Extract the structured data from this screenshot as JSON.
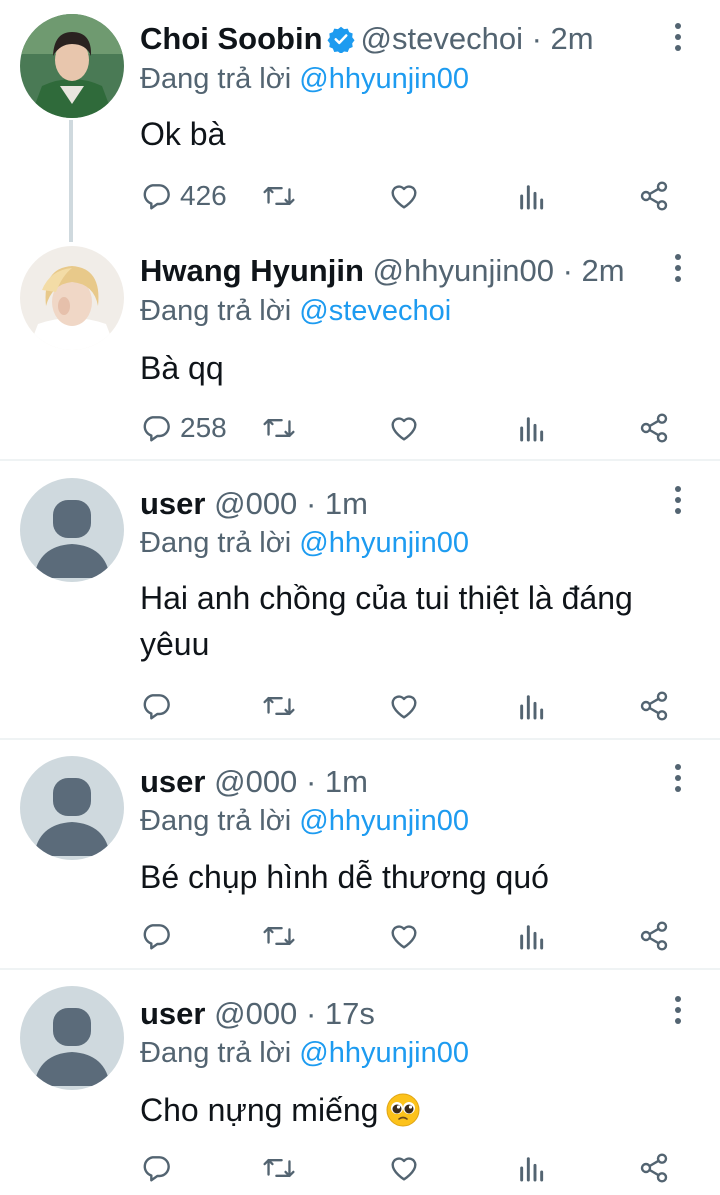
{
  "tweets": [
    {
      "name": "Choi Soobin",
      "verified": true,
      "handle": "@stevechoi",
      "dot": "·",
      "time": "2m",
      "reply_prefix": "Đang trả lời",
      "reply_to": "@hhyunjin00",
      "text": "Ok bà",
      "reply_count": "426",
      "avatar": "photo-green-jacket"
    },
    {
      "name": "Hwang Hyunjin",
      "verified": false,
      "handle": "@hhyunjin00",
      "dot": "·",
      "time": "2m",
      "reply_prefix": "Đang trả lời",
      "reply_to": "@stevechoi",
      "text": "Bà qq",
      "reply_count": "258",
      "avatar": "photo-blonde"
    },
    {
      "name": "user",
      "verified": false,
      "handle": "@000",
      "dot": "·",
      "time": "1m",
      "reply_prefix": "Đang trả lời",
      "reply_to": "@hhyunjin00",
      "text": "Hai anh chồng của tui thiệt là đáng yêuu",
      "reply_count": "",
      "avatar": "default"
    },
    {
      "name": "user",
      "verified": false,
      "handle": "@000",
      "dot": "·",
      "time": "1m",
      "reply_prefix": "Đang trả lời",
      "reply_to": "@hhyunjin00",
      "text": "Bé chụp hình dễ thương quó",
      "reply_count": "",
      "avatar": "default"
    },
    {
      "name": "user",
      "verified": false,
      "handle": "@000",
      "dot": "·",
      "time": "17s",
      "reply_prefix": "Đang trả lời",
      "reply_to": "@hhyunjin00",
      "text": "Cho nựng miếng",
      "reply_count": "",
      "avatar": "default",
      "emoji": "pleading-face-emoji"
    }
  ],
  "colors": {
    "accent": "#1d9bf0",
    "muted": "#536471",
    "text": "#0f1419",
    "divider": "#eff3f4",
    "thread_line": "#cfd9de",
    "default_avatar_bg": "#cfd9de",
    "default_avatar_fg": "#5b6b7a"
  },
  "icons": {
    "reply": "reply-icon",
    "retweet": "retweet-icon",
    "like": "heart-icon",
    "views": "analytics-icon",
    "share": "share-icon",
    "more": "more-vertical-icon",
    "verified": "verified-badge-icon"
  }
}
